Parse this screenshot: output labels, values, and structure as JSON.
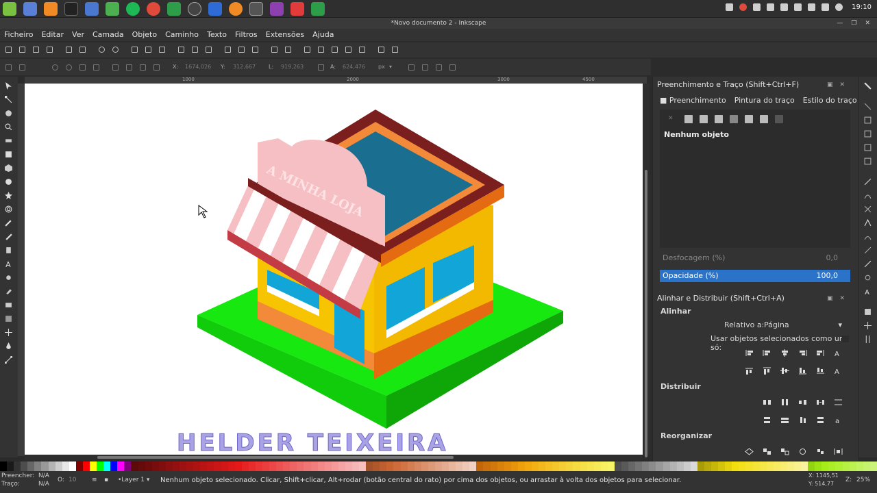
{
  "window_title": "*Novo documento 2 - Inkscape",
  "clock": "19:10",
  "menu": [
    "Ficheiro",
    "Editar",
    "Ver",
    "Camada",
    "Objeto",
    "Caminho",
    "Texto",
    "Filtros",
    "Extensões",
    "Ajuda"
  ],
  "ctrl": {
    "x_label": "X:",
    "x_value": "1674,026",
    "y_label": "Y:",
    "y_value": "312,667",
    "w_label": "L:",
    "w_value": "919,263",
    "h_label": "A:",
    "h_value": "624,476",
    "unit": "px"
  },
  "ruler": [
    "1000",
    "1500",
    "2000",
    "2500",
    "3000",
    "3500",
    "4000",
    "4500"
  ],
  "fill_stroke": {
    "title": "Preenchimento e Traço (Shift+Ctrl+F)",
    "tabs": [
      "Preenchimento",
      "Pintura do traço",
      "Estilo do traço"
    ],
    "no_object": "Nenhum objeto",
    "blur_label": "Desfocagem (%)",
    "blur_value": "0,0",
    "opacity_label": "Opacidade (%)",
    "opacity_value": "100,0",
    "opacity_fraction": 1.0
  },
  "align": {
    "title": "Alinhar e Distribuir (Shift+Ctrl+A)",
    "section_align": "Alinhar",
    "relative_label": "Relativo a:",
    "relative_value": "Página",
    "treat_label": "Usar objetos selecionados como um só:",
    "section_distribute": "Distribuir",
    "section_rearrange": "Reorganizar"
  },
  "artwork": {
    "sign_text": "A MINHA LOJA",
    "watermark": "HELDER TEIXEIRA",
    "colors": {
      "grass": "#17e80f",
      "grass_side": "#11b40a",
      "wall": "#f6c400",
      "wall_dark": "#e0a800",
      "roof": "#1a6f90",
      "trim": "#7a1e1e",
      "trim_orange": "#f28a3a",
      "awning_pink": "#f6bfc3",
      "awning_white": "#ffffff",
      "awning_red": "#c23b45",
      "glass": "#12a6d8"
    }
  },
  "status": {
    "fill_label": "Preencher:",
    "fill_value": "N/A",
    "stroke_label": "Traço:",
    "stroke_value": "N/A",
    "opacity_label": "O:",
    "opacity_value": "10",
    "layer": "•Layer 1",
    "message": "Nenhum objeto selecionado. Clicar, Shift+clicar, Alt+rodar (botão central do rato) por cima dos objetos, ou arrastar à volta dos objetos para selecionar.",
    "cursor_x": "X: 1145,51",
    "cursor_y": "Y: 514,77",
    "zoom_label": "Z:",
    "zoom_value": "25%"
  }
}
